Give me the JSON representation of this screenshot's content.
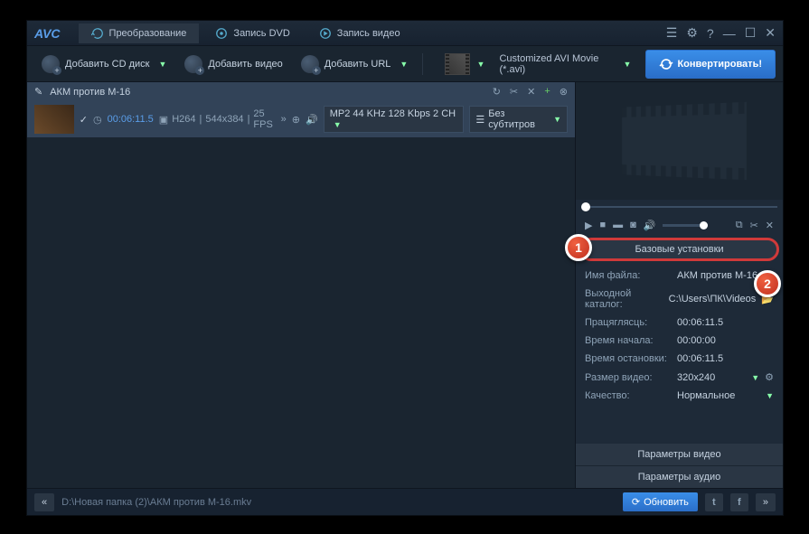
{
  "app": {
    "logo": "AVC"
  },
  "tabs": {
    "convert": "Преобразование",
    "dvd": "Запись DVD",
    "video": "Запись видео"
  },
  "titlebar": {
    "list_icon": "☰",
    "gear_icon": "⚙",
    "help_icon": "?",
    "min_icon": "—",
    "max_icon": "☐",
    "close_icon": "✕"
  },
  "toolbar": {
    "add_cd": "Добавить CD диск",
    "add_video": "Добавить видео",
    "add_url": "Добавить URL",
    "format_label": "Customized AVI Movie (*.avi)",
    "convert": "Конвертировать!"
  },
  "item": {
    "title": "АКМ против М-16",
    "duration": "00:06:11.5",
    "codec": "H264",
    "resolution": "544x384",
    "fps": "25 FPS",
    "audio": "MP2 44 KHz 128 Kbps 2 CH",
    "subtitles": "Без субтитров",
    "refresh": "↻",
    "cut": "✂",
    "fx": "✕",
    "plus": "+",
    "close": "⊗",
    "check": "✓",
    "clock": "◷",
    "vcodec_ico": "▣",
    "arrow": "»",
    "globe": "⊕",
    "snd": "🔊",
    "sub_ico": "☰"
  },
  "player": {
    "play": "▶",
    "stop": "■",
    "mute": "▬",
    "cam": "◙",
    "snd": "🔊",
    "pop": "⧉",
    "cut": "✂",
    "fx": "✕"
  },
  "sections": {
    "basic": "Базовые установки",
    "video": "Параметры видео",
    "audio": "Параметры аудио"
  },
  "settings": {
    "filename": {
      "label": "Имя файла:",
      "value": "АКМ против М-16"
    },
    "outdir": {
      "label": "Выходной каталог:",
      "value": "C:\\Users\\ПК\\Videos",
      "icon": "📂"
    },
    "duration": {
      "label": "Працяглясць:",
      "value": "00:06:11.5"
    },
    "start": {
      "label": "Время начала:",
      "value": "00:00:00"
    },
    "stop": {
      "label": "Время остановки:",
      "value": "00:06:11.5"
    },
    "size": {
      "label": "Размер видео:",
      "value": "320x240",
      "gear": "⚙"
    },
    "quality": {
      "label": "Качество:",
      "value": "Нормальное"
    }
  },
  "status": {
    "left": "«",
    "path": "D:\\Новая папка (2)\\АКМ против М-16.mkv",
    "update": "Обновить",
    "upd_icon": "⟳",
    "tw": "t",
    "fb": "f",
    "right": "»"
  },
  "badges": {
    "one": "1",
    "two": "2"
  }
}
